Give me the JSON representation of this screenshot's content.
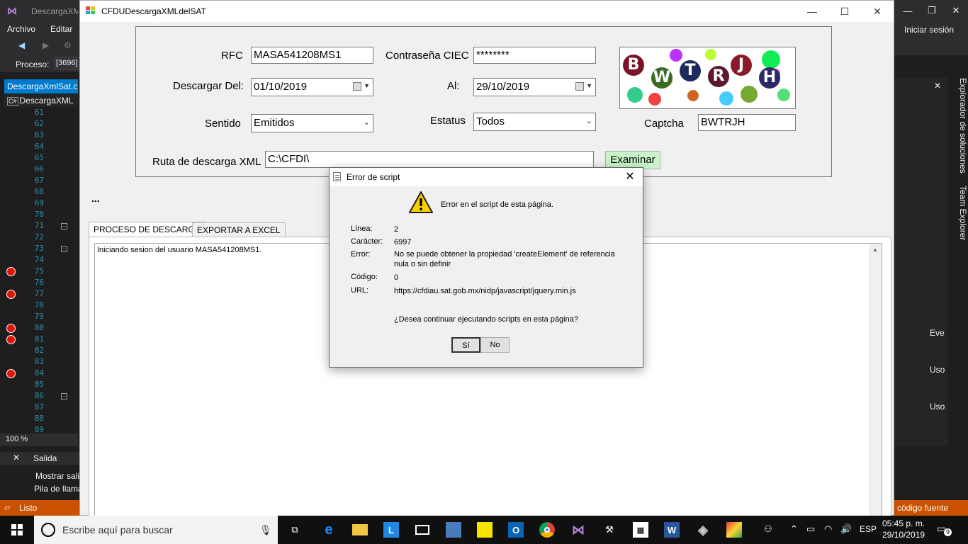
{
  "vs": {
    "title": "DescargaXML",
    "menus": [
      "Archivo",
      "Editar"
    ],
    "sign_in": "Iniciar sesión",
    "process_label": "Proceso:",
    "process_value": "[3696]",
    "active_tab": "DescargaXmlSat.cs",
    "nav_item": "DescargaXML",
    "line_numbers": [
      "61",
      "62",
      "63",
      "64",
      "65",
      "66",
      "67",
      "68",
      "69",
      "70",
      "71",
      "72",
      "73",
      "74",
      "75",
      "76",
      "77",
      "78",
      "79",
      "80",
      "81",
      "82",
      "83",
      "84",
      "85",
      "86",
      "87",
      "88",
      "89"
    ],
    "zoom": "100 %",
    "output_title": "Salida",
    "output_show": "Mostrar salida",
    "call_stack": "Pila de llamadas",
    "status": "Listo",
    "status_right": "código fuente",
    "solution_explorer": "Explorador de soluciones",
    "team_explorer": "Team Explorer",
    "right_items": [
      "Eve",
      "Uso",
      "Uso"
    ]
  },
  "app": {
    "title": "CFDUDescargaXMLdelSAT",
    "form": {
      "rfc_label": "RFC",
      "rfc_value": "MASA541208MS1",
      "password_label": "Contraseña CIEC",
      "password_value": "********",
      "from_label": "Descargar Del:",
      "from_value": "01/10/2019",
      "to_label": "Al:",
      "to_value": "29/10/2019",
      "direction_label": "Sentido",
      "direction_value": "Emitidos",
      "status_label": "Estatus",
      "status_value": "Todos",
      "captcha_label": "Captcha",
      "captcha_value": "BWTRJH",
      "captcha_letters": [
        "B",
        "W",
        "T",
        "R",
        "J",
        "H"
      ],
      "path_label": "Ruta de descarga XML",
      "path_value": "C:\\CFDI\\",
      "browse_label": "Examinar"
    },
    "ellipsis": "...",
    "tabs": [
      {
        "label": "PROCESO DE DESCARGA",
        "active": true
      },
      {
        "label": "EXPORTAR A EXCEL",
        "active": false
      }
    ],
    "log": "Iniciando sesion del usuario MASA541208MS1."
  },
  "dialog": {
    "title": "Error de script",
    "heading": "Error en el script de esta página.",
    "fields": [
      {
        "key": "Línea:",
        "value": "2"
      },
      {
        "key": "Carácter:",
        "value": "6997"
      },
      {
        "key": "Error:",
        "value": "No se puede obtener la propiedad 'createElement' de referencia nula o sin definir"
      },
      {
        "key": "Código:",
        "value": "0"
      },
      {
        "key": "URL:",
        "value": "https://cfdiau.sat.gob.mx/nidp/javascript/jquery.min.js"
      }
    ],
    "question": "¿Desea continuar ejecutando scripts en esta página?",
    "yes_label": "Sí",
    "no_label": "No"
  },
  "taskbar": {
    "search_placeholder": "Escribe aquí para buscar",
    "language": "ESP",
    "time": "05:45 p. m.",
    "date": "29/10/2019",
    "notification_count": "9"
  }
}
